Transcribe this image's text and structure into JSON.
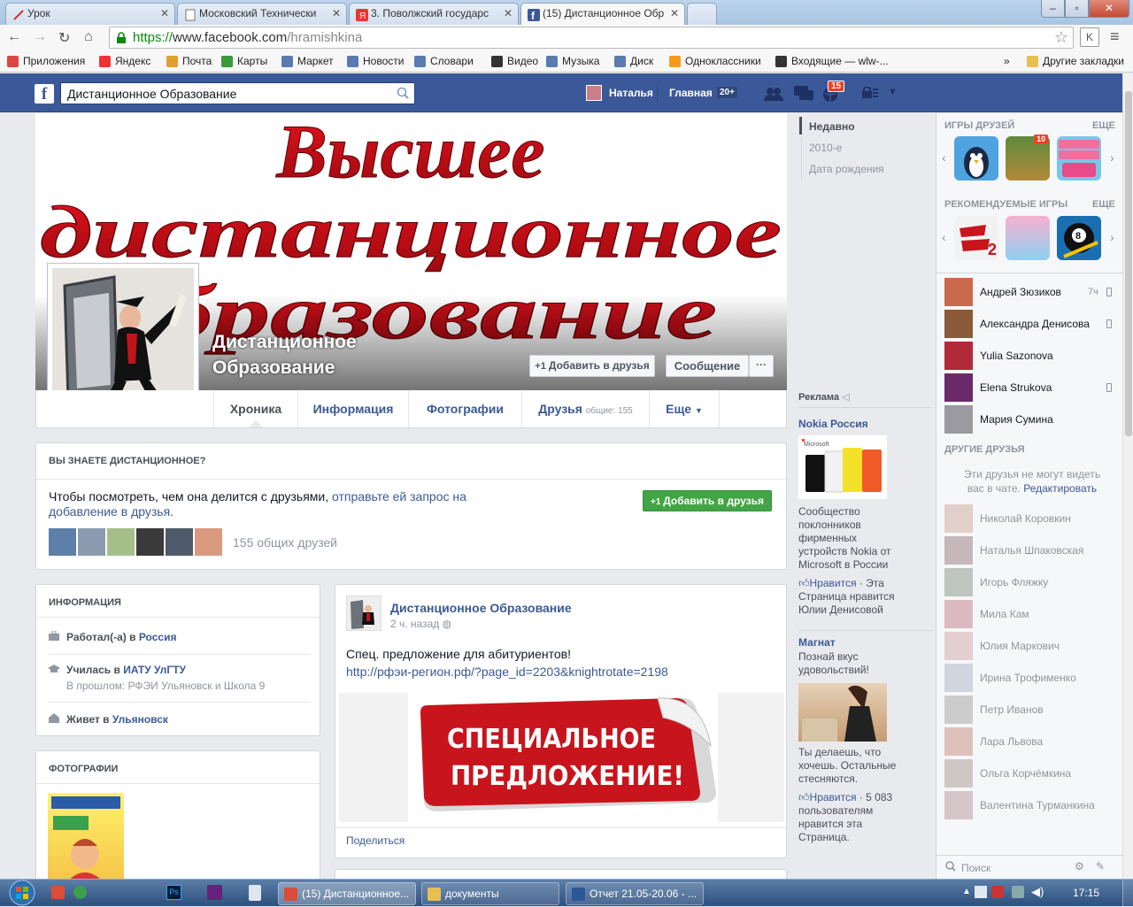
{
  "browser": {
    "tabs": [
      {
        "title": "Урок",
        "icon": "slash-icon"
      },
      {
        "title": "Московский Технически",
        "icon": "doc-icon"
      },
      {
        "title": "3. Поволжский государс",
        "icon": "yandex-icon"
      },
      {
        "title": "(15) Дистанционное Обр",
        "icon": "facebook-icon"
      }
    ],
    "url_scheme": "https://",
    "url_host": "www.facebook.com",
    "url_path": "/hramishkina",
    "bookmarks": [
      {
        "label": "Приложения",
        "color": "#d44"
      },
      {
        "label": "Яндекс",
        "color": "#e33"
      },
      {
        "label": "Почта",
        "color": "#e0a030"
      },
      {
        "label": "Карты",
        "color": "#3a9a3a"
      },
      {
        "label": "Маркет",
        "color": "#5a7ab0"
      },
      {
        "label": "Новости",
        "color": "#5a7ab0"
      },
      {
        "label": "Словари",
        "color": "#5a7ab0"
      },
      {
        "label": "Видео",
        "color": "#333"
      },
      {
        "label": "Музыка",
        "color": "#5a7ab0"
      },
      {
        "label": "Диск",
        "color": "#5a7ab0"
      },
      {
        "label": "Одноклассники",
        "color": "#f39a1c"
      },
      {
        "label": "Входящие — wlw-...",
        "color": "#333"
      }
    ],
    "bookmarks_overflow": "»",
    "other_bookmarks": "Другие закладки"
  },
  "fb_header": {
    "search_value": "Дистанционное Образование",
    "user_name": "Наталья",
    "home_label": "Главная",
    "home_badge": "20+",
    "notif_badge": "15"
  },
  "cover": {
    "line1": "Высшее",
    "line2": "дистанционное",
    "line3": "образование"
  },
  "profile": {
    "name": "Дистанционное Образование",
    "add_friend": "Добавить в друзья",
    "message": "Сообщение",
    "more_dots": "···"
  },
  "nav": {
    "timeline": "Хроника",
    "about": "Информация",
    "photos": "Фотографии",
    "friends": "Друзья",
    "friends_common": "общие: 155",
    "more": "Еще"
  },
  "know_card": {
    "title": "ВЫ ЗНАЕТЕ ДИСТАНЦИОННОЕ?",
    "text_plain": "Чтобы посмотреть, чем она делится с друзьями,",
    "text_link": " отправьте ей запрос на добавление в друзья.",
    "button": "Добавить в друзья",
    "mutual": "155 общих друзей"
  },
  "info_card": {
    "title": "ИНФОРМАЦИЯ",
    "work_prefix": "Работал(-а) в ",
    "work_place": "Россия",
    "study_prefix": "Училась в ",
    "study_place": "ИАТУ УлГТУ",
    "study_past": "В прошлом: РФЭИ Ульяновск и Школа 9",
    "lives_prefix": "Живет в ",
    "lives_place": "Ульяновск"
  },
  "photos_card": {
    "title": "ФОТОГРАФИИ"
  },
  "post": {
    "author": "Дистанционное Образование",
    "time": "2 ч. назад",
    "text": "Спец. предложение для абитуриентов!",
    "link": "http://рфэи-регион.рф/?page_id=2203&knightrotate=2198",
    "banner_line1": "СПЕЦИАЛЬНОЕ",
    "banner_line2": "ПРЕДЛОЖЕНИЕ!",
    "share": "Поделиться"
  },
  "timeline_years": {
    "recent": "Недавно",
    "year": "2010-е",
    "birth": "Дата рождения"
  },
  "ads": {
    "header": "Реклама",
    "ad1_title": "Nokia Россия",
    "ad1_text": "Сообщество поклонников фирменных устройств Nokia от Microsoft в России",
    "ad1_like": "Нравится",
    "ad1_like_rest": " · Эта Страница нравится Юлии Денисовой",
    "ad2_title": "Магнат",
    "ad2_sub": "Познай вкус удовольствий!",
    "ad2_text": "Ты делаешь, что хочешь. Остальные стесняются.",
    "ad2_like": "Нравится",
    "ad2_like_rest": " · 5 083 пользователям нравится эта Страница."
  },
  "chat": {
    "games_header": "ИГРЫ ДРУЗЕЙ",
    "games_more": "ЕЩЕ",
    "game_badge": "10",
    "rec_header": "РЕКОМЕНДУЕМЫЕ ИГРЫ",
    "rec_more": "ЕЩЕ",
    "online": [
      {
        "name": "Андрей Зюзиков",
        "meta": "7ч",
        "color": "#c96a4a"
      },
      {
        "name": "Александра Денисова",
        "meta": "",
        "color": "#8a5a3a"
      },
      {
        "name": "Yulia Sazonova",
        "meta": "",
        "color": "#b02a3a"
      },
      {
        "name": "Elena Strukova",
        "meta": "",
        "color": "#6a2a6a"
      },
      {
        "name": "Мария Сумина",
        "meta": "",
        "color": "#9a9aa0"
      }
    ],
    "other_header": "ДРУГИЕ ДРУЗЬЯ",
    "other_note": "Эти друзья не могут видеть вас в чате.",
    "other_edit": "Редактировать",
    "others": [
      {
        "name": "Николай Коровкин",
        "color": "#c9a090"
      },
      {
        "name": "Наталья Шпаковская",
        "color": "#8a6a70"
      },
      {
        "name": "Игорь Фляжку",
        "color": "#7a8a7a"
      },
      {
        "name": "Мила Кам",
        "color": "#c07080"
      },
      {
        "name": "Юлия Маркович",
        "color": "#d0a0a0"
      },
      {
        "name": "Ирина Трофименко",
        "color": "#a0b0c0"
      },
      {
        "name": "Петр Иванов",
        "color": "#9a9a9a"
      },
      {
        "name": "Лара Львова",
        "color": "#c08070"
      },
      {
        "name": "Ольга Корчёмкина",
        "color": "#a09080"
      },
      {
        "name": "Валентина Турманкина",
        "color": "#b08a90"
      }
    ],
    "search": "Поиск"
  },
  "taskbar": {
    "items": [
      {
        "label": "(15) Дистанционное...",
        "color": "#dd4b39"
      },
      {
        "label": "документы",
        "color": "#e8c050"
      },
      {
        "label": "Отчет 21.05-20.06 - ...",
        "color": "#2b5797"
      }
    ],
    "time": "17:15"
  }
}
